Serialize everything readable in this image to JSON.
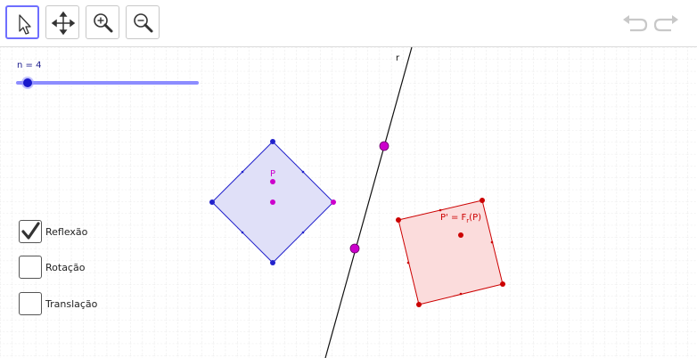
{
  "toolbar": {
    "tools": [
      "move-tool",
      "move-graphics-view-tool",
      "zoom-in-tool",
      "zoom-out-tool"
    ],
    "selected_tool": "move-tool"
  },
  "slider": {
    "label": "n = 4",
    "value": 4
  },
  "labels": {
    "line": "r",
    "point_p": "P",
    "image_prefix": "P' = F",
    "image_sub": "r",
    "image_suffix": "(P)"
  },
  "checkboxes": [
    {
      "label": "Reflexão",
      "checked": true
    },
    {
      "label": "Rotação",
      "checked": false
    },
    {
      "label": "Translação",
      "checked": false
    }
  ],
  "colors": {
    "blue": "#2222cc",
    "blue_fill": "#e0e0f8",
    "red": "#cc0000",
    "red_fill": "#fbdcdc",
    "magenta": "#cc00cc",
    "slider": "#8c8cff"
  }
}
